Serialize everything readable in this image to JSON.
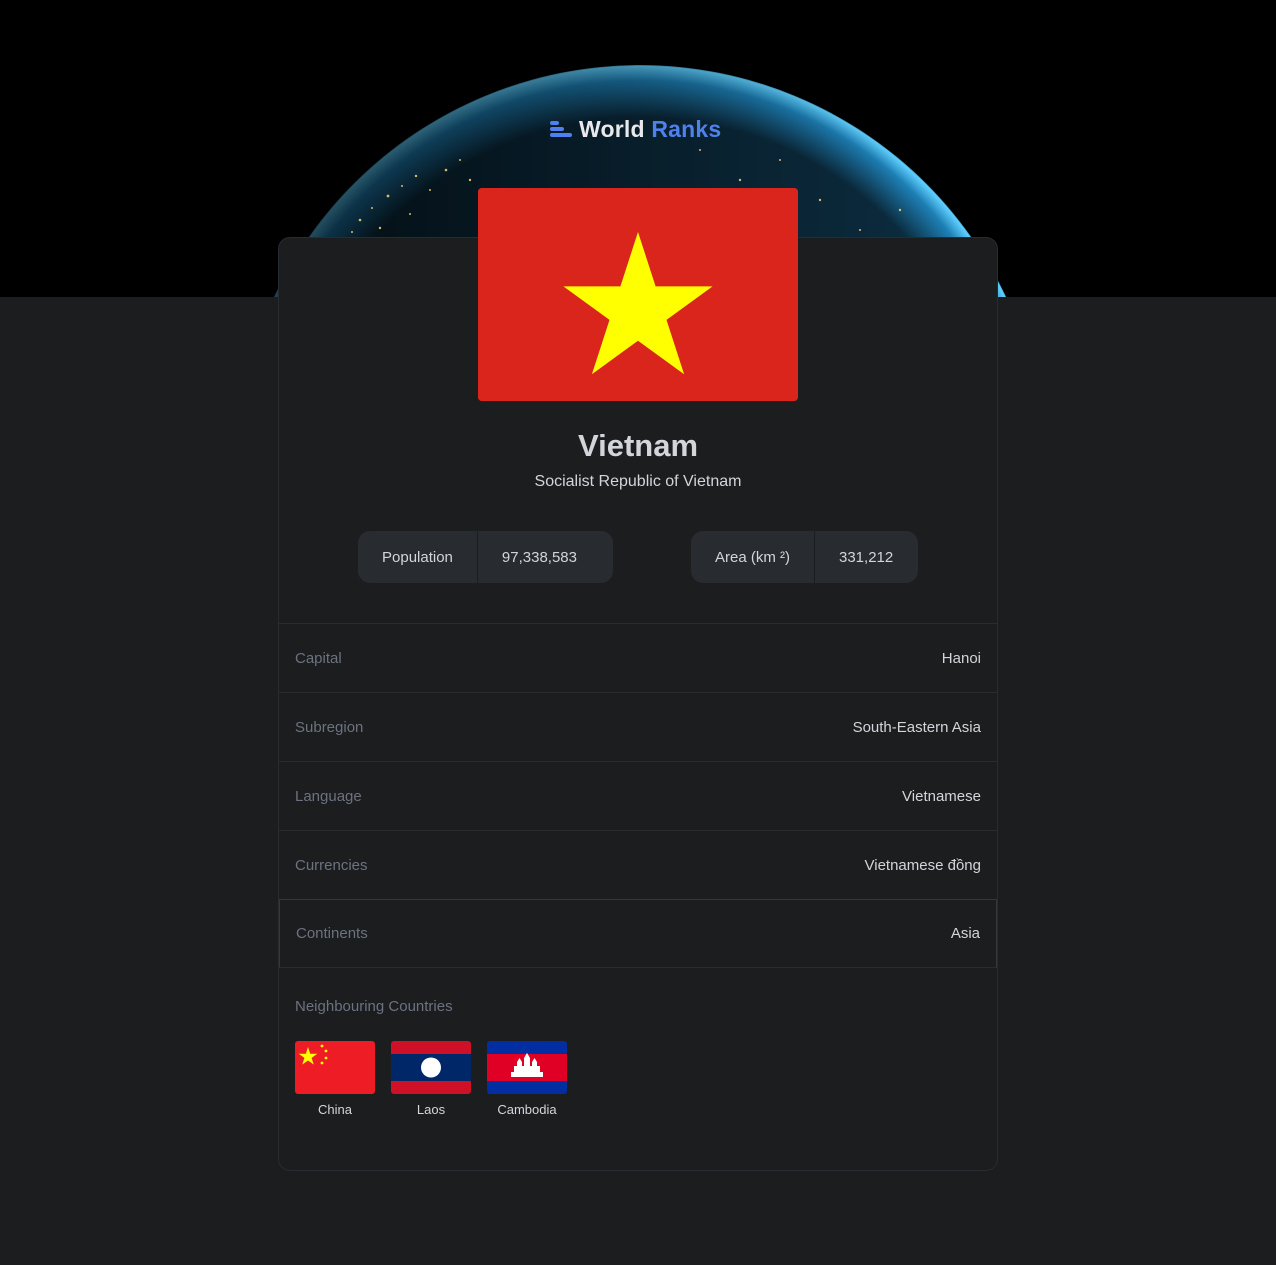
{
  "app": {
    "logo_word1": "World",
    "logo_word2": "Ranks",
    "logo_icon": "bar-ranking-icon",
    "accent_color": "#4e80ee",
    "background_color": "#1b1d1f"
  },
  "country": {
    "name": "Vietnam",
    "official_name": "Socialist Republic of Vietnam",
    "flag_icon": "vietnam-flag",
    "stats": {
      "population_label": "Population",
      "population_value": "97,338,583",
      "area_label": "Area (km ²)",
      "area_value": "331,212"
    },
    "details": [
      {
        "label": "Capital",
        "value": "Hanoi"
      },
      {
        "label": "Subregion",
        "value": "South-Eastern Asia"
      },
      {
        "label": "Language",
        "value": "Vietnamese"
      },
      {
        "label": "Currencies",
        "value": "Vietnamese đồng"
      },
      {
        "label": "Continents",
        "value": "Asia"
      }
    ]
  },
  "neighbours": {
    "title": "Neighbouring Countries",
    "items": [
      {
        "name": "China",
        "flag_icon": "china-flag"
      },
      {
        "name": "Laos",
        "flag_icon": "laos-flag"
      },
      {
        "name": "Cambodia",
        "flag_icon": "cambodia-flag"
      }
    ]
  }
}
